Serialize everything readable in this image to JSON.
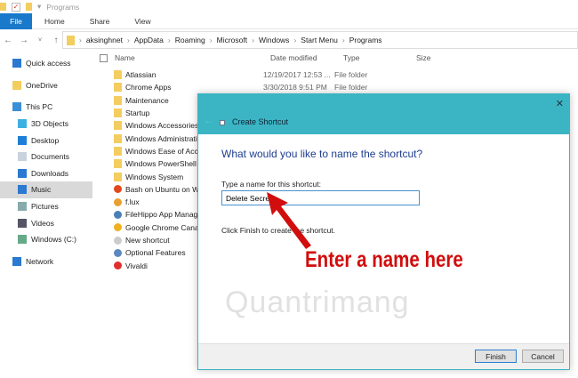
{
  "window": {
    "title": "Programs"
  },
  "ribbon": {
    "tabs": [
      "File",
      "Home",
      "Share",
      "View"
    ]
  },
  "address": {
    "crumbs": [
      "aksinghnet",
      "AppData",
      "Roaming",
      "Microsoft",
      "Windows",
      "Start Menu",
      "Programs"
    ]
  },
  "sidebar": {
    "items": [
      {
        "label": "Quick access",
        "icon": "star-icon",
        "color": "#2b79d0",
        "indent": false
      },
      {
        "label": "OneDrive",
        "icon": "folder-icon",
        "color": "#f3cd5f",
        "indent": false
      },
      {
        "label": "This PC",
        "icon": "computer-icon",
        "color": "#3a8fd8",
        "indent": false
      },
      {
        "label": "3D Objects",
        "icon": "cube-icon",
        "color": "#3cb0e0",
        "indent": true
      },
      {
        "label": "Desktop",
        "icon": "desktop-icon",
        "color": "#1e7fd8",
        "indent": true
      },
      {
        "label": "Documents",
        "icon": "document-icon",
        "color": "#c9d3dd",
        "indent": true
      },
      {
        "label": "Downloads",
        "icon": "download-icon",
        "color": "#2b79d0",
        "indent": true
      },
      {
        "label": "Music",
        "icon": "music-icon",
        "color": "#2b79d0",
        "indent": true,
        "selected": true
      },
      {
        "label": "Pictures",
        "icon": "pictures-icon",
        "color": "#8aa",
        "indent": true
      },
      {
        "label": "Videos",
        "icon": "video-icon",
        "color": "#556",
        "indent": true
      },
      {
        "label": "Windows (C:)",
        "icon": "drive-icon",
        "color": "#6a8",
        "indent": true
      },
      {
        "label": "Network",
        "icon": "network-icon",
        "color": "#2b79d0",
        "indent": false
      }
    ]
  },
  "columns": [
    "Name",
    "Date modified",
    "Type",
    "Size"
  ],
  "files": [
    {
      "name": "Atlassian",
      "date": "12/19/2017 12:53 ...",
      "type": "File folder",
      "kind": "folder"
    },
    {
      "name": "Chrome Apps",
      "date": "3/30/2018 9:51 PM",
      "type": "File folder",
      "kind": "folder"
    },
    {
      "name": "Maintenance",
      "kind": "folder"
    },
    {
      "name": "Startup",
      "kind": "folder"
    },
    {
      "name": "Windows Accessories",
      "kind": "folder"
    },
    {
      "name": "Windows Administrative Tools",
      "kind": "folder"
    },
    {
      "name": "Windows Ease of Access",
      "kind": "folder"
    },
    {
      "name": "Windows PowerShell",
      "kind": "folder"
    },
    {
      "name": "Windows System",
      "kind": "folder"
    },
    {
      "name": "Bash on Ubuntu on Windows",
      "kind": "app",
      "color": "#e2481c"
    },
    {
      "name": "f.lux",
      "kind": "app",
      "color": "#e8a030"
    },
    {
      "name": "FileHippo App Manager",
      "kind": "app",
      "color": "#4a7fb8"
    },
    {
      "name": "Google Chrome Canary",
      "kind": "app",
      "color": "#f0b020"
    },
    {
      "name": "New shortcut",
      "kind": "app",
      "color": "#ccc"
    },
    {
      "name": "Optional Features",
      "kind": "app",
      "color": "#5a88c0"
    },
    {
      "name": "Vivaldi",
      "kind": "app",
      "color": "#e0302e"
    }
  ],
  "dialog": {
    "title": "Create Shortcut",
    "question": "What would you like to name the shortcut?",
    "label": "Type a name for this shortcut:",
    "value": "Delete Secret",
    "hint": "Click Finish to create the shortcut.",
    "finish": "Finish",
    "cancel": "Cancel"
  },
  "annotation": {
    "text": "Enter a name here",
    "color": "#d10d0d"
  },
  "watermark": "Quantrimang"
}
